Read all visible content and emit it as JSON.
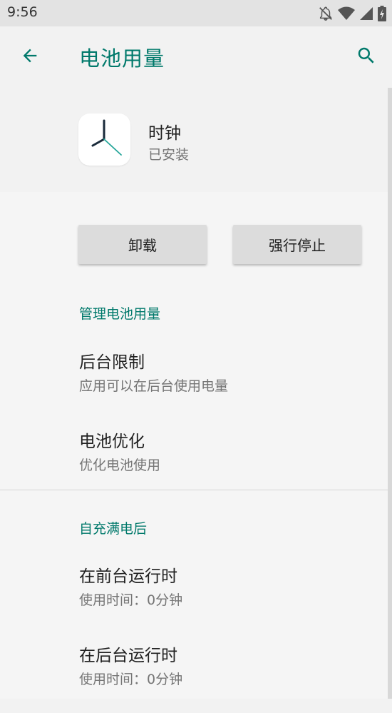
{
  "status_bar": {
    "time": "9:56",
    "icons": [
      "notifications-off-icon",
      "wifi-icon",
      "cellular-signal-icon",
      "battery-charging-icon"
    ]
  },
  "app_bar": {
    "title": "电池用量",
    "back_icon": "arrow-back-icon",
    "search_icon": "search-icon",
    "accent_color": "#00796b"
  },
  "app_header": {
    "name": "时钟",
    "status": "已安装",
    "icon": "clock-app-icon"
  },
  "actions": {
    "uninstall_label": "卸载",
    "force_stop_label": "强行停止"
  },
  "manage_section": {
    "header": "管理电池用量",
    "items": [
      {
        "title": "后台限制",
        "summary": "应用可以在后台使用电量"
      },
      {
        "title": "电池优化",
        "summary": "优化电池使用"
      }
    ]
  },
  "since_full_charge_section": {
    "header": "自充满电后",
    "items": [
      {
        "title": "在前台运行时",
        "summary": "使用时间：0分钟"
      },
      {
        "title": "在后台运行时",
        "summary": "使用时间：0分钟"
      }
    ]
  }
}
